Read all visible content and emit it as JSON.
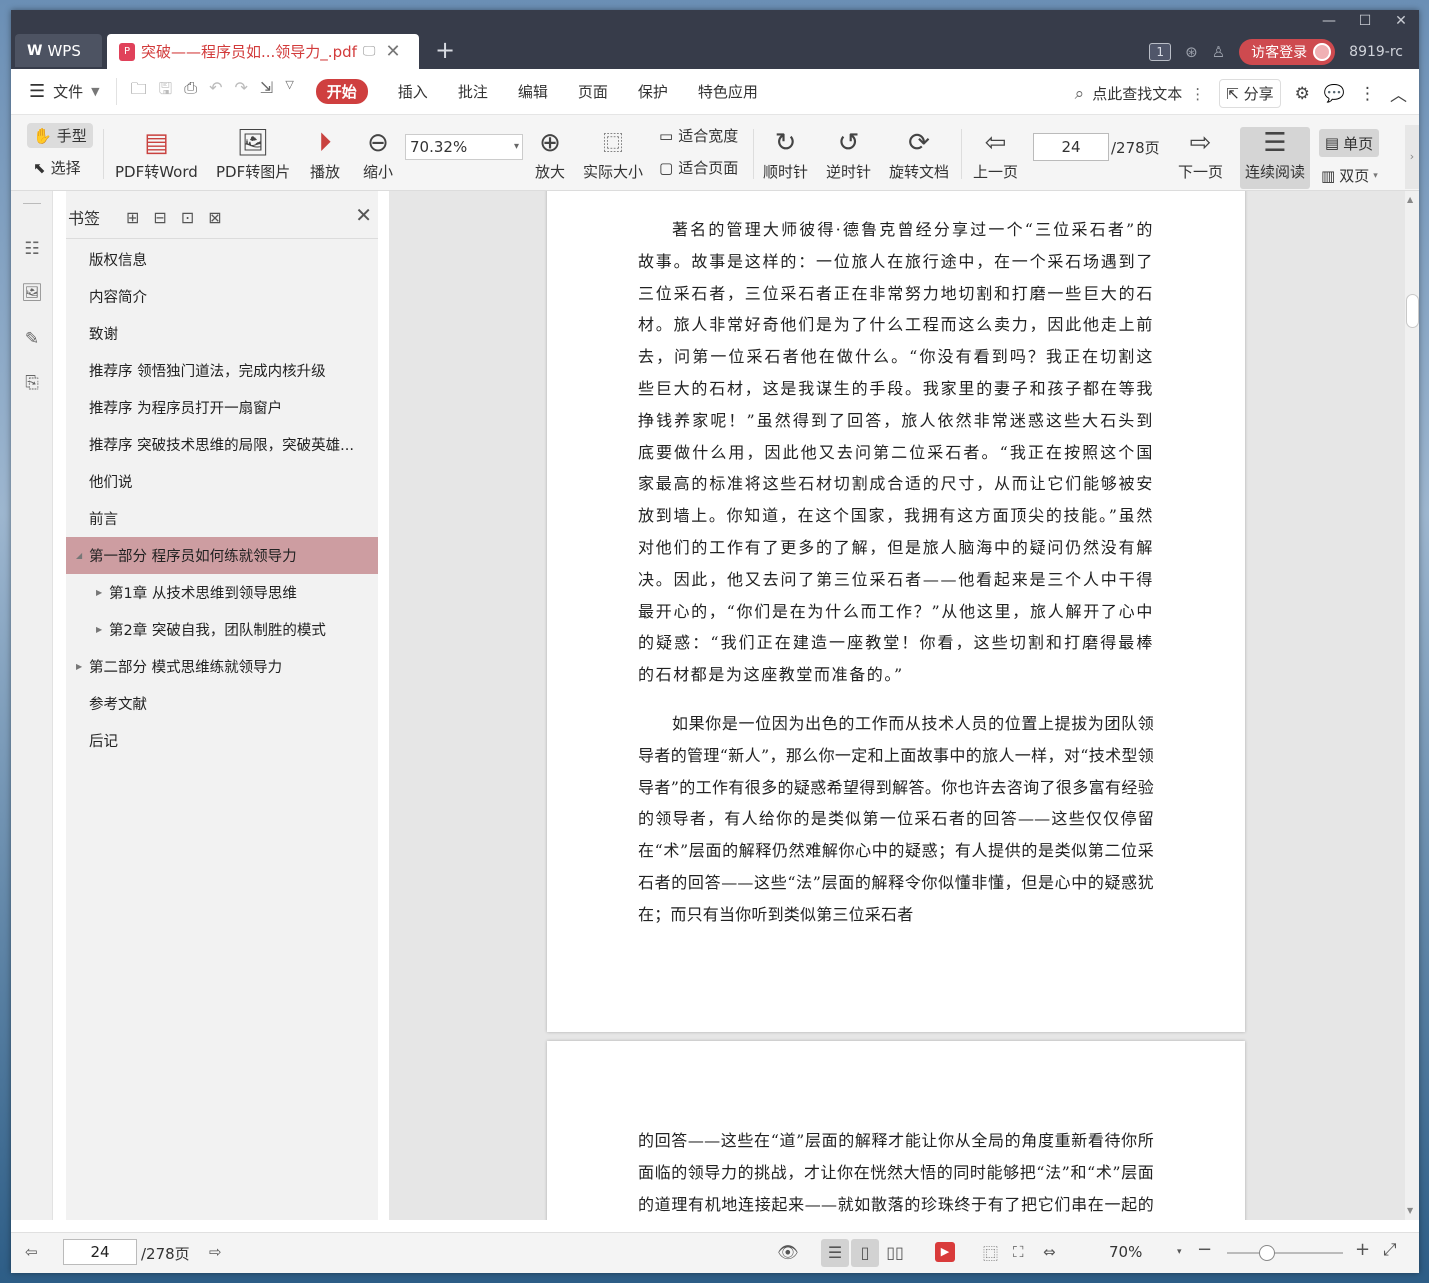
{
  "window": {
    "controls": [
      "—",
      "☐",
      "✕"
    ]
  },
  "tabs": {
    "app_tab": "WPS",
    "doc_tab_title": "突破——程序员如...领导力_.pdf",
    "new_tab": "+"
  },
  "titlebar": {
    "badge": "1",
    "login_label": "访客登录",
    "user_name": "8919-rc"
  },
  "menu": {
    "file": "文件",
    "items": [
      "开始",
      "插入",
      "批注",
      "编辑",
      "页面",
      "保护",
      "特色应用"
    ],
    "search_text": "点此查找文本",
    "share": "分享"
  },
  "ribbon": {
    "hand": "手型",
    "select": "选择",
    "pdf_to_word": "PDF转Word",
    "pdf_to_image": "PDF转图片",
    "play": "播放",
    "zoom_out": "缩小",
    "zoom_value": "70.32%",
    "zoom_in": "放大",
    "actual_size": "实际大小",
    "fit_width": "适合宽度",
    "fit_page": "适合页面",
    "clockwise": "顺时针",
    "counterclockwise": "逆时针",
    "rotate_doc": "旋转文档",
    "prev_page": "上一页",
    "current_page": "24",
    "total_pages": "/278页",
    "next_page": "下一页",
    "continuous": "连续阅读",
    "single_page": "单页",
    "double_page": "双页"
  },
  "bookmarks": {
    "title": "书签",
    "items": [
      {
        "label": "版权信息",
        "level": 0,
        "arrow": "",
        "selected": false
      },
      {
        "label": "内容简介",
        "level": 0,
        "arrow": "",
        "selected": false
      },
      {
        "label": "致谢",
        "level": 0,
        "arrow": "",
        "selected": false
      },
      {
        "label": "推荐序 领悟独门道法，完成内核升级",
        "level": 0,
        "arrow": "",
        "selected": false
      },
      {
        "label": "推荐序 为程序员打开一扇窗户",
        "level": 0,
        "arrow": "",
        "selected": false
      },
      {
        "label": "推荐序 突破技术思维的局限，突破英雄...",
        "level": 0,
        "arrow": "",
        "selected": false
      },
      {
        "label": "他们说",
        "level": 0,
        "arrow": "",
        "selected": false
      },
      {
        "label": "前言",
        "level": 0,
        "arrow": "",
        "selected": false
      },
      {
        "label": "第一部分 程序员如何练就领导力",
        "level": 0,
        "arrow": "◢",
        "selected": true
      },
      {
        "label": "第1章 从技术思维到领导思维",
        "level": 1,
        "arrow": "▶",
        "selected": false
      },
      {
        "label": "第2章 突破自我，团队制胜的模式",
        "level": 1,
        "arrow": "▶",
        "selected": false
      },
      {
        "label": "第二部分 模式思维练就领导力",
        "level": 0,
        "arrow": "▶",
        "selected": false
      },
      {
        "label": "参考文献",
        "level": 0,
        "arrow": "",
        "selected": false
      },
      {
        "label": "后记",
        "level": 0,
        "arrow": "",
        "selected": false
      }
    ]
  },
  "document": {
    "page1_para1": "著名的管理大师彼得·德鲁克曾经分享过一个“三位采石者”的故事。故事是这样的：一位旅人在旅行途中，在一个采石场遇到了三位采石者，三位采石者正在非常努力地切割和打磨一些巨大的石材。旅人非常好奇他们是为了什么工程而这么卖力，因此他走上前去，问第一位采石者他在做什么。“你没有看到吗？我正在切割这些巨大的石材，这是我谋生的手段。我家里的妻子和孩子都在等我挣钱养家呢！”虽然得到了回答，旅人依然非常迷惑这些大石头到底要做什么用，因此他又去问第二位采石者。“我正在按照这个国家最高的标准将这些石材切割成合适的尺寸，从而让它们能够被安放到墙上。你知道，在这个国家，我拥有这方面顶尖的技能。”虽然对他们的工作有了更多的了解，但是旅人脑海中的疑问仍然没有解决。因此，他又去问了第三位采石者——他看起来是三个人中干得最开心的，“你们是在为什么而工作？”从他这里，旅人解开了心中的疑惑：“我们正在建造一座教堂！你看，这些切割和打磨得最棒的石材都是为这座教堂而准备的。”",
    "page1_para2": "如果你是一位因为出色的工作而从技术人员的位置上提拔为团队领导者的管理“新人”，那么你一定和上面故事中的旅人一样，对“技术型领导者”的工作有很多的疑惑希望得到解答。你也许去咨询了很多富有经验的领导者，有人给你的是类似第一位采石者的回答——这些仅仅停留在“术”层面的解释仍然难解你心中的疑惑；有人提供的是类似第二位采石者的回答——这些“法”层面的解释令你似懂非懂，但是心中的疑惑犹在；而只有当你听到类似第三位采石者",
    "page2_para1": "的回答——这些在“道”层面的解释才能让你从全局的角度重新看待你所面临的领导力的挑战，才让你在恍然大悟的同时能够把“法”和“术”层面的道理有机地连接起来——就如散落的珍珠终于有了把它们串在一起的主线，向前迈出的相当一段距离，使你的领导力有所提升。"
  },
  "statusbar": {
    "page": "24",
    "total": "/278页",
    "zoom": "70%"
  },
  "colors": {
    "titlebar": "#373c4a",
    "accent_red": "#cf3f3f",
    "bookmark_selected": "#cd9da1"
  }
}
